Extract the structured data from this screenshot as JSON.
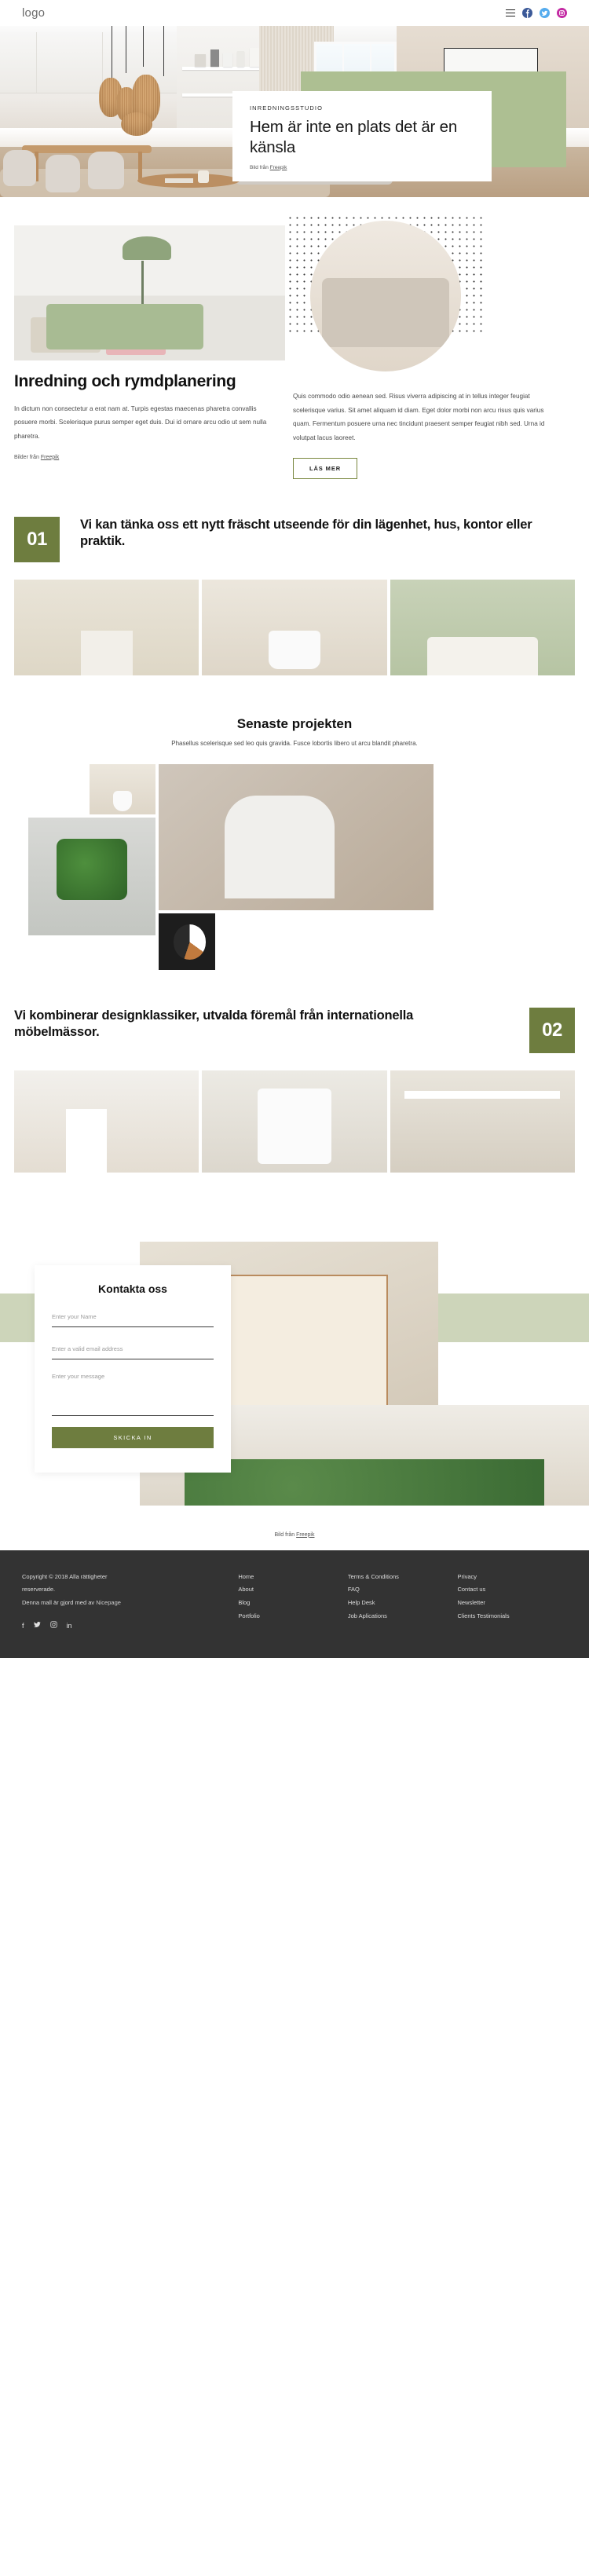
{
  "header": {
    "logo": "logo",
    "menu_icon": "hamburger-icon",
    "social": [
      "facebook-icon",
      "twitter-icon",
      "instagram-icon"
    ]
  },
  "colors": {
    "accent_green": "#adbf92",
    "dark_green": "#6e7d3f",
    "pale_green": "#cdd5ba",
    "footer_bg": "#333333"
  },
  "hero": {
    "kicker": "INREDNINGSSTUDIO",
    "title": "Hem är inte en plats det är en känsla",
    "credit_prefix": "Bild från ",
    "credit_link": "Freepik"
  },
  "section_interior": {
    "heading": "Inredning och rymdplanering",
    "paragraph_left": "In dictum non consectetur a erat nam at. Turpis egestas maecenas pharetra convallis posuere morbi. Scelerisque purus semper eget duis. Dui id ornare arcu odio ut sem nulla pharetra.",
    "credit_prefix": "Bilder från ",
    "credit_link": "Freepik",
    "paragraph_right": "Quis commodo odio aenean sed. Risus viverra adipiscing at in tellus integer feugiat scelerisque varius. Sit amet aliquam id diam. Eget dolor morbi non arcu risus quis varius quam. Fermentum posuere urna nec tincidunt praesent semper feugiat nibh sed. Urna id volutpat lacus laoreet.",
    "button": "LÄS MER"
  },
  "section_01": {
    "number": "01",
    "heading": "Vi kan tänka oss ett nytt fräscht utseende för din lägenhet, hus, kontor eller praktik."
  },
  "projects": {
    "heading": "Senaste projekten",
    "subtitle": "Phasellus scelerisque sed leo quis gravida. Fusce lobortis libero ut arcu blandit pharetra."
  },
  "section_02": {
    "number": "02",
    "heading": "Vi kombinerar designklassiker, utvalda föremål från internationella möbelmässor."
  },
  "contact": {
    "heading": "Kontakta oss",
    "name_placeholder": "Enter your Name",
    "email_placeholder": "Enter a valid email address",
    "message_placeholder": "Enter your message",
    "submit": "SKICKA IN",
    "credit_prefix": "Bild från ",
    "credit_link": "Freepik"
  },
  "footer": {
    "copyright_line1": "Copyright © 2018 Alla rättigheter",
    "copyright_line2": "reserverade.",
    "made_prefix": "Denna mall är gjord med av ",
    "made_link": "Nicepage",
    "columns": [
      {
        "links": [
          "Home",
          "About",
          "Blog",
          "Portfolio"
        ]
      },
      {
        "links": [
          "Terms & Conditions",
          "FAQ",
          "Help Desk",
          "Job Aplications"
        ]
      },
      {
        "links": [
          "Privacy",
          "Contact us",
          "Newsletter",
          "Clients Testimonials"
        ]
      }
    ],
    "social": [
      "facebook-icon",
      "twitter-icon",
      "instagram-icon",
      "linkedin-icon"
    ]
  }
}
